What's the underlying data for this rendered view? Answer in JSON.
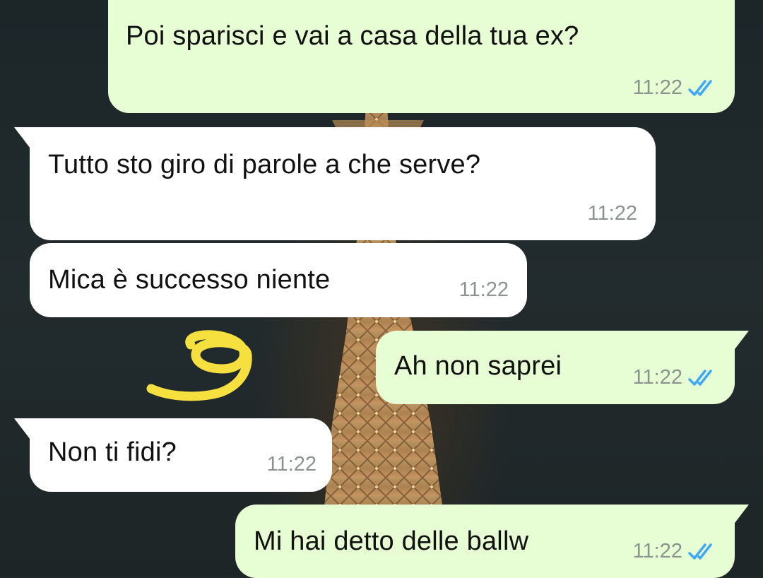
{
  "colors": {
    "outgoing_bubble": "#e7fdd4",
    "incoming_bubble": "#ffffff",
    "read_ticks": "#3fa9f5",
    "timestamp": "#8a938e",
    "scribble": "#f5e040"
  },
  "chat": {
    "messages": [
      {
        "direction": "outgoing",
        "text": "Poi sparisci e vai a casa della tua ex?",
        "time": "11:22",
        "status_icon": "double-check-read-icon"
      },
      {
        "direction": "incoming",
        "text": "Tutto sto giro di parole a che serve?",
        "time": "11:22"
      },
      {
        "direction": "incoming",
        "text": "Mica è successo niente",
        "time": "11:22"
      },
      {
        "direction": "outgoing",
        "text": "Ah non saprei",
        "time": "11:22",
        "status_icon": "double-check-read-icon"
      },
      {
        "direction": "incoming",
        "text": "Non ti fidi?",
        "time": "11:22"
      },
      {
        "direction": "outgoing",
        "text": "Mi hai detto delle ballw",
        "time": "11:22",
        "status_icon": "double-check-read-icon"
      }
    ]
  },
  "wallpaper": {
    "icon": "eiffel-tower-night-wallpaper"
  },
  "annotation": {
    "icon": "yellow-hand-drawn-scribble"
  }
}
